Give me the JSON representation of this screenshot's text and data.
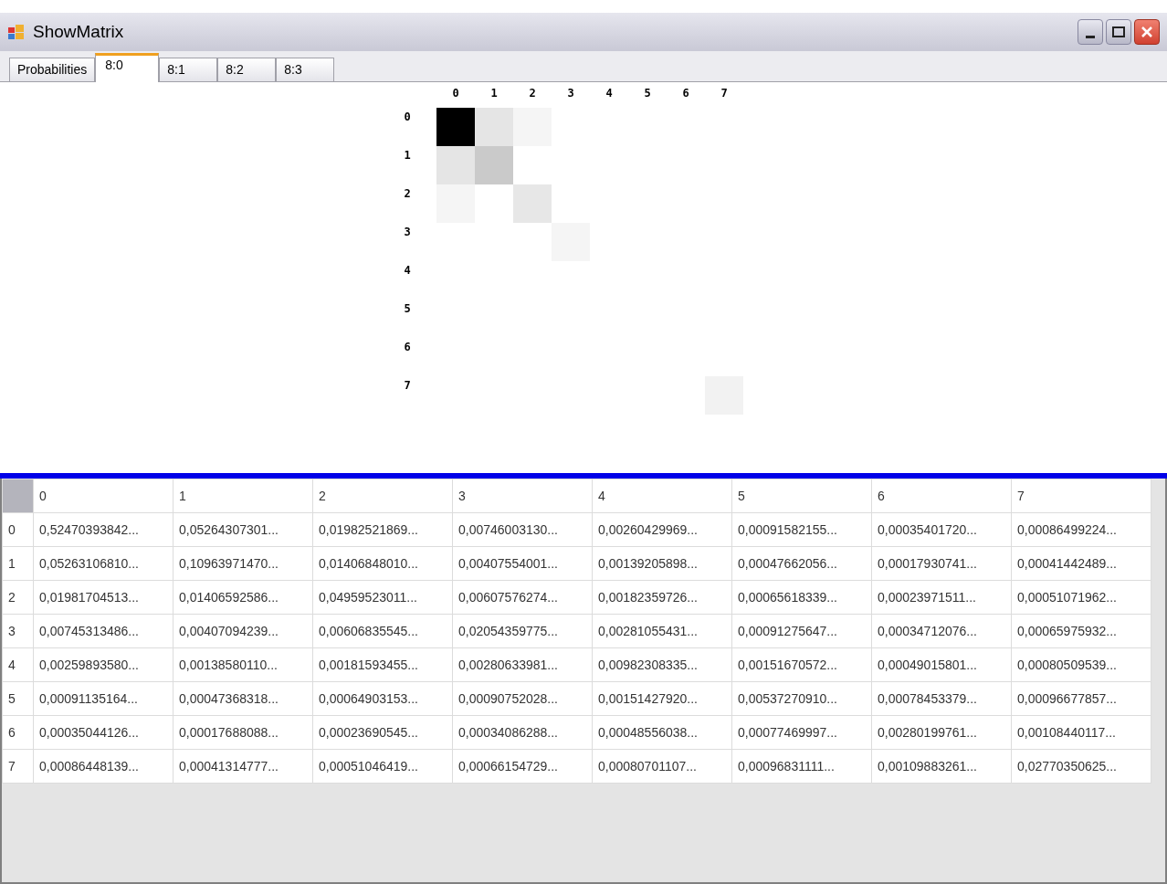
{
  "window": {
    "title": "ShowMatrix"
  },
  "tabs": [
    {
      "label": "Probabilities",
      "selected": false
    },
    {
      "label": "8:0",
      "selected": true
    },
    {
      "label": "8:1",
      "selected": false
    },
    {
      "label": "8:2",
      "selected": false
    },
    {
      "label": "8:3",
      "selected": false
    }
  ],
  "heatmap": {
    "column_labels": [
      "0",
      "1",
      "2",
      "3",
      "4",
      "5",
      "6",
      "7"
    ],
    "row_labels": [
      "0",
      "1",
      "2",
      "3",
      "4",
      "5",
      "6",
      "7"
    ]
  },
  "table": {
    "columns": [
      "0",
      "1",
      "2",
      "3",
      "4",
      "5",
      "6",
      "7"
    ],
    "rows": [
      {
        "header": "0",
        "cells": [
          "0,52470393842...",
          "0,05264307301...",
          "0,01982521869...",
          "0,00746003130...",
          "0,00260429969...",
          "0,00091582155...",
          "0,00035401720...",
          "0,00086499224..."
        ]
      },
      {
        "header": "1",
        "cells": [
          "0,05263106810...",
          "0,10963971470...",
          "0,01406848010...",
          "0,00407554001...",
          "0,00139205898...",
          "0,00047662056...",
          "0,00017930741...",
          "0,00041442489..."
        ]
      },
      {
        "header": "2",
        "cells": [
          "0,01981704513...",
          "0,01406592586...",
          "0,04959523011...",
          "0,00607576274...",
          "0,00182359726...",
          "0,00065618339...",
          "0,00023971511...",
          "0,00051071962..."
        ]
      },
      {
        "header": "3",
        "cells": [
          "0,00745313486...",
          "0,00407094239...",
          "0,00606835545...",
          "0,02054359775...",
          "0,00281055431...",
          "0,00091275647...",
          "0,00034712076...",
          "0,00065975932..."
        ]
      },
      {
        "header": "4",
        "cells": [
          "0,00259893580...",
          "0,00138580110...",
          "0,00181593455...",
          "0,00280633981...",
          "0,00982308335...",
          "0,00151670572...",
          "0,00049015801...",
          "0,00080509539..."
        ]
      },
      {
        "header": "5",
        "cells": [
          "0,00091135164...",
          "0,00047368318...",
          "0,00064903153...",
          "0,00090752028...",
          "0,00151427920...",
          "0,00537270910...",
          "0,00078453379...",
          "0,00096677857..."
        ]
      },
      {
        "header": "6",
        "cells": [
          "0,00035044126...",
          "0,00017688088...",
          "0,00023690545...",
          "0,00034086288...",
          "0,00048556038...",
          "0,00077469997...",
          "0,00280199761...",
          "0,00108440117..."
        ]
      },
      {
        "header": "7",
        "cells": [
          "0,00086448139...",
          "0,00041314777...",
          "0,00051046419...",
          "0,00066154729...",
          "0,00080701107...",
          "0,00096831111...",
          "0,00109883261...",
          "0,02770350625..."
        ]
      }
    ]
  }
}
